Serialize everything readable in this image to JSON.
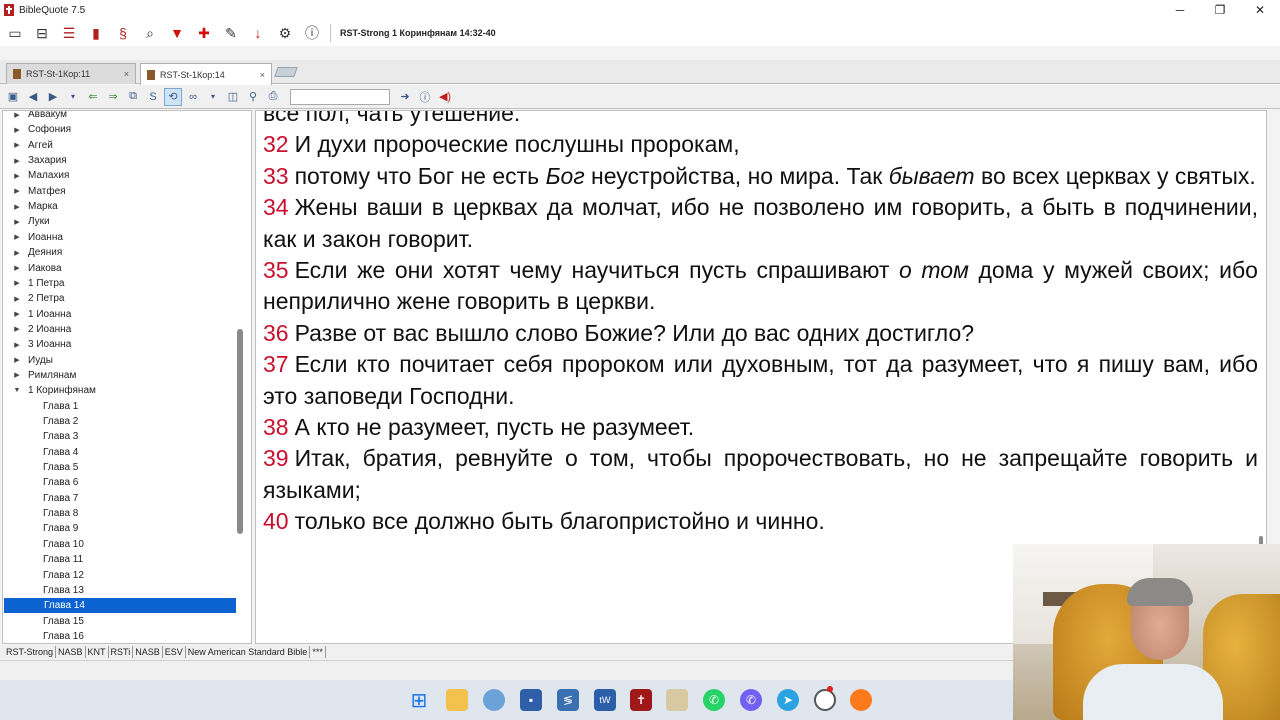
{
  "window": {
    "title": "BibleQuote 7.5",
    "controls": [
      "─",
      "❐",
      "✕"
    ]
  },
  "toolbar": {
    "reference": "RST-Strong 1 Коринфянам 14:32-40",
    "icons": [
      "window-icon",
      "split-icon",
      "list-icon",
      "book-icon",
      "strong-icon",
      "search-icon",
      "bookmark-icon",
      "bookmark-add-icon",
      "notes-icon",
      "download-icon",
      "settings-icon",
      "info-icon"
    ]
  },
  "tabs": [
    {
      "label": "RST-St-1Кор:11",
      "close": "×"
    },
    {
      "label": "RST-St-1Кор:14",
      "close": "×"
    }
  ],
  "search": {
    "value": ""
  },
  "tree": {
    "books": [
      "Аввакум",
      "Софония",
      "Аггей",
      "Захария",
      "Малахия",
      "Матфея",
      "Марка",
      "Луки",
      "Иоанна",
      "Деяния",
      "Иакова",
      "1 Петра",
      "2 Петра",
      "1 Иоанна",
      "2 Иоанна",
      "3 Иоанна",
      "Иуды",
      "Римлянам",
      "1 Коринфянам"
    ],
    "chapters": [
      "Глава 1",
      "Глава 2",
      "Глава 3",
      "Глава 4",
      "Глава 5",
      "Глава 6",
      "Глава 7",
      "Глава 8",
      "Глава 9",
      "Глава 10",
      "Глава 11",
      "Глава 12",
      "Глава 13",
      "Глава 14",
      "Глава 15",
      "Глава 16"
    ],
    "selected_chapter": "Глава 14"
  },
  "verses": [
    {
      "num": "",
      "text": "всё пол, чать утешение."
    },
    {
      "num": "32",
      "text": "И духи пророческие послушны пророкам,"
    },
    {
      "num": "33",
      "text_parts": [
        "потому что Бог не есть ",
        "Бог",
        " неустройства, но мира. Так ",
        "бывает",
        " во всех церквах у святых."
      ]
    },
    {
      "num": "34",
      "text": "Жены ваши в церквах да молчат, ибо не позволено им говорить, а быть в подчинении, как и закон говорит."
    },
    {
      "num": "35",
      "text_parts": [
        "Если же они хотят чему научиться пусть спрашивают ",
        "о том",
        " дома у мужей своих; ибо неприлично жене говорить в церкви."
      ]
    },
    {
      "num": "36",
      "text": "Разве от вас вышло слово Божие? Или до вас одних достигло?"
    },
    {
      "num": "37",
      "text": "Если кто почитает себя пророком или духовным, тот да разумеет, что я пишу вам, ибо это заповеди Господни."
    },
    {
      "num": "38",
      "text": "А кто не разумеет, пусть не разумеет."
    },
    {
      "num": "39",
      "text": "Итак, братия, ревнуйте о том, чтобы пророчествовать, но не запрещайте говорить и языками;"
    },
    {
      "num": "40",
      "text": "только все должно быть благопристойно и чинно."
    }
  ],
  "modules": [
    "RST-Strong",
    "NASB",
    "KNT",
    "RSTi",
    "NASB",
    "ESV",
    "New American Standard Bible",
    "***"
  ],
  "taskbar": {
    "apps": [
      "windows-start-icon",
      "file-explorer-icon",
      "app-icon",
      "save-icon",
      "vscode-icon",
      "tw-icon",
      "biblequote-icon",
      "archive-icon",
      "whatsapp-icon",
      "viber-icon",
      "telegram-icon",
      "chrome-icon",
      "firefox-icon"
    ]
  },
  "colors": {
    "verse_number": "#c8102e",
    "selection": "#0a63d1"
  }
}
